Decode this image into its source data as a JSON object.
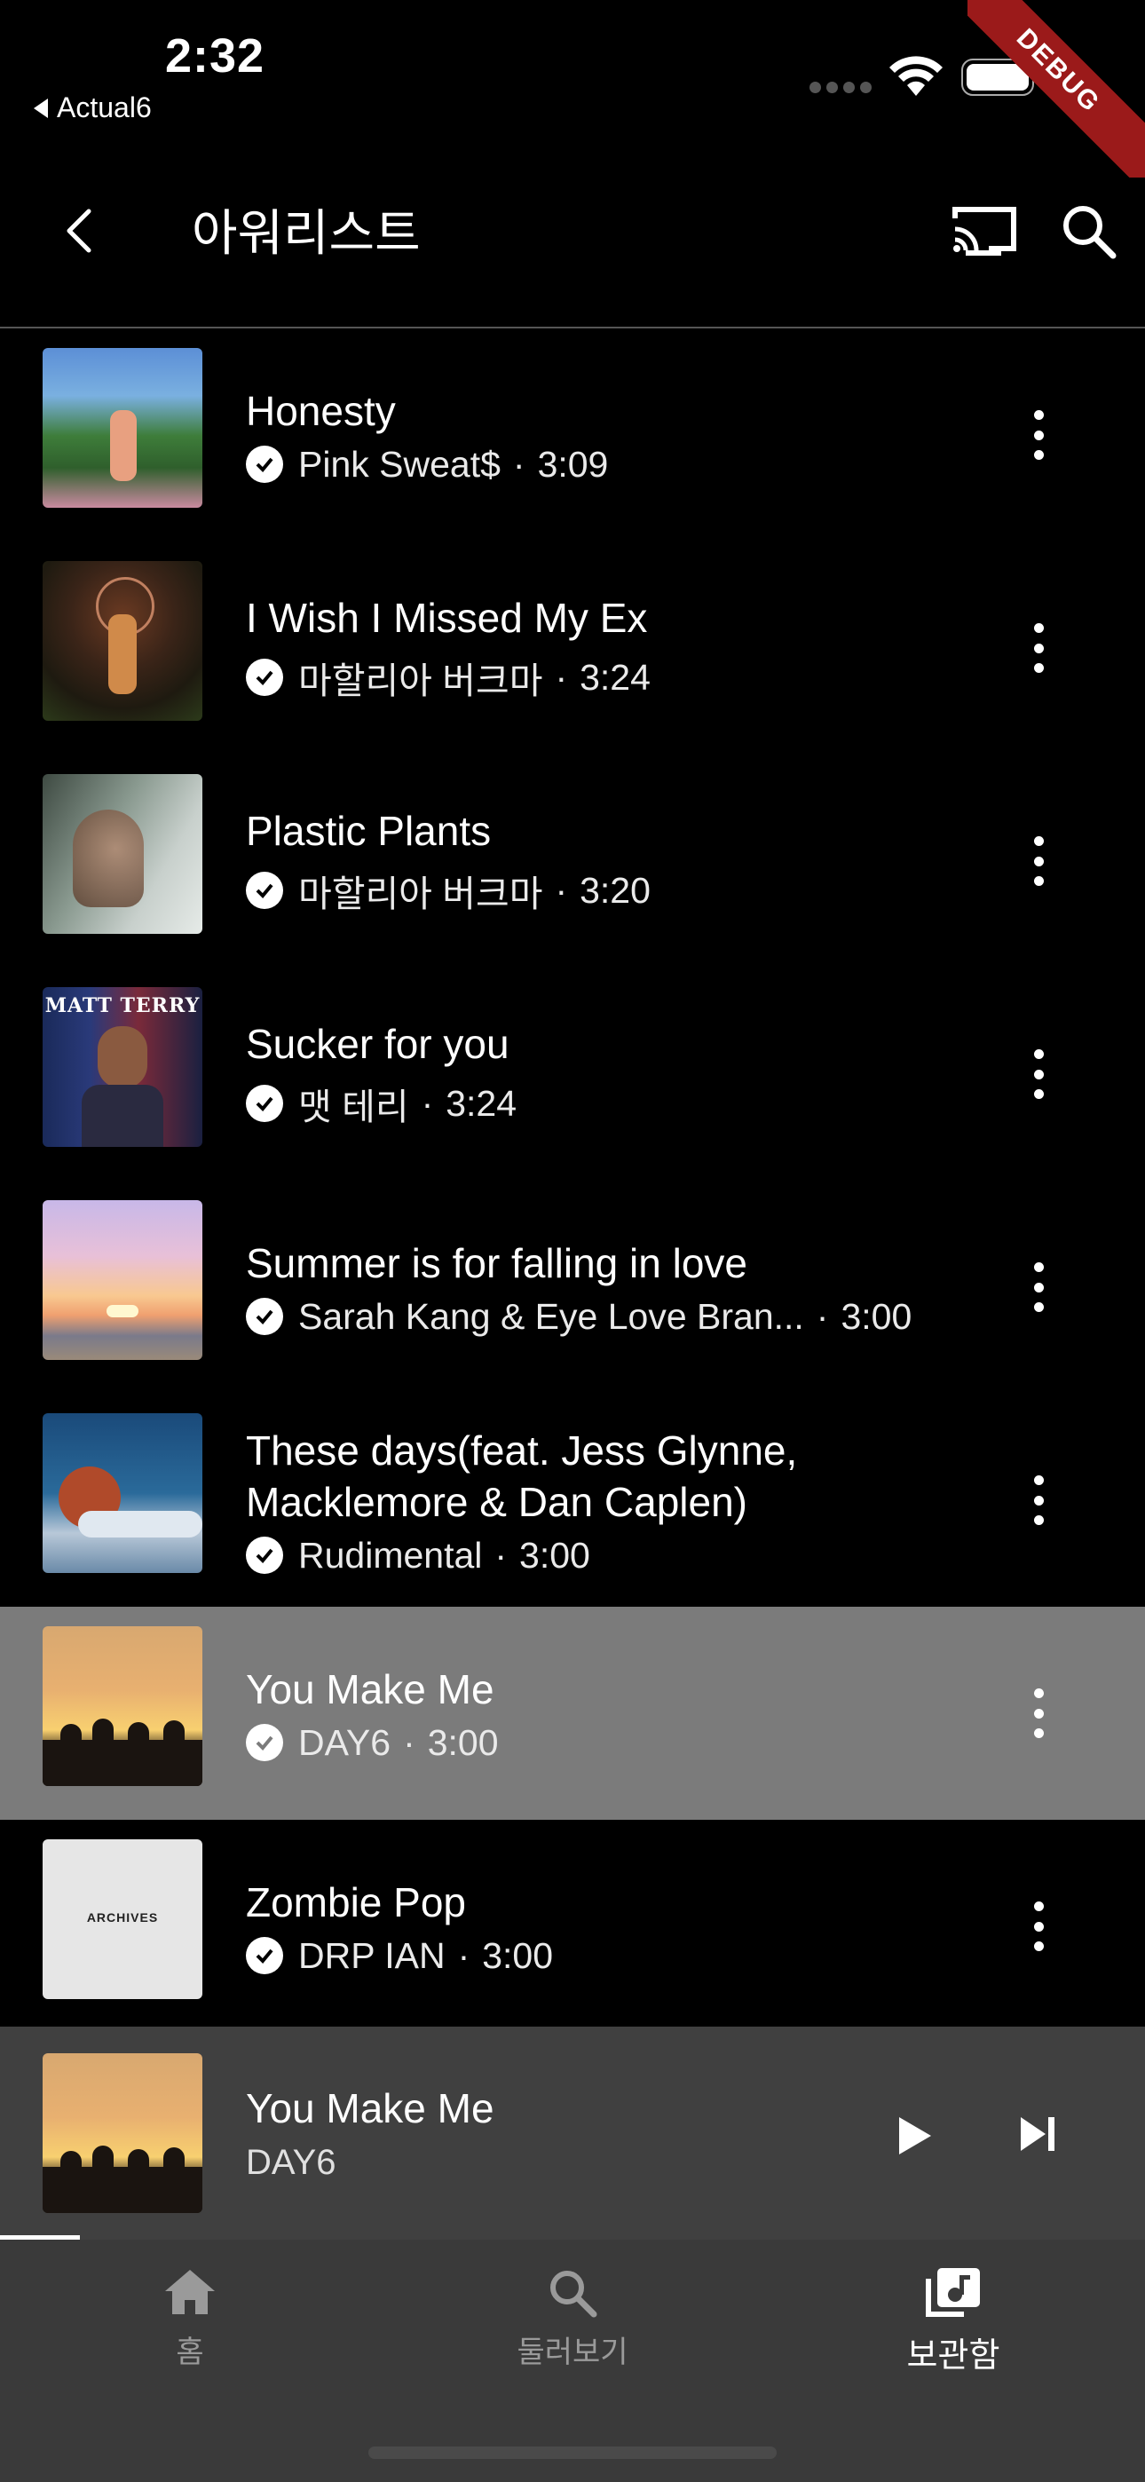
{
  "status_bar": {
    "time": "2:32",
    "back_app": "Actual6",
    "debug_label": "DEBUG"
  },
  "header": {
    "title": "아워리스트"
  },
  "songs": [
    {
      "title": "Honesty",
      "artist": "Pink Sweat$",
      "duration": "3:09",
      "sep": "·",
      "art": "art-honesty"
    },
    {
      "title": "I Wish I Missed My Ex",
      "artist": "마할리아 버크마",
      "duration": "3:24",
      "sep": "·",
      "art": "art-wish"
    },
    {
      "title": "Plastic Plants",
      "artist": "마할리아 버크마",
      "duration": "3:20",
      "sep": "·",
      "art": "art-plastic"
    },
    {
      "title": "Sucker for you",
      "artist": "맷 테리",
      "duration": "3:24",
      "sep": "·",
      "art": "art-sucker",
      "art_text": "MATT TERRY"
    },
    {
      "title": "Summer is for falling in love",
      "artist": "Sarah Kang & Eye Love Bran...",
      "duration": "3:00",
      "sep": "·",
      "art": "art-summer"
    },
    {
      "title": "These days(feat. Jess Glynne, Macklemore & Dan Caplen)",
      "artist": "Rudimental",
      "duration": "3:00",
      "sep": "·",
      "art": "art-these"
    },
    {
      "title": "You Make Me",
      "artist": "DAY6",
      "duration": "3:00",
      "sep": "·",
      "art": "art-day6",
      "selected": true
    },
    {
      "title": "Zombie Pop",
      "artist": "DRP IAN",
      "duration": "3:00",
      "sep": "·",
      "art": "art-zombie",
      "art_text": "ARCHIVES"
    }
  ],
  "mini_player": {
    "title": "You Make Me",
    "artist": "DAY6",
    "progress": 0.07
  },
  "bottom_nav": {
    "items": [
      {
        "label": "홈",
        "icon": "home-icon",
        "active": false
      },
      {
        "label": "둘러보기",
        "icon": "search-icon",
        "active": false
      },
      {
        "label": "보관함",
        "icon": "library-music-icon",
        "active": true
      }
    ]
  },
  "colors": {
    "background": "#000000",
    "selected_row": "#7b7b7b",
    "mini_player": "#404040",
    "nav_bar": "#3a3a3a",
    "debug_ribbon": "#9b1a1a"
  }
}
